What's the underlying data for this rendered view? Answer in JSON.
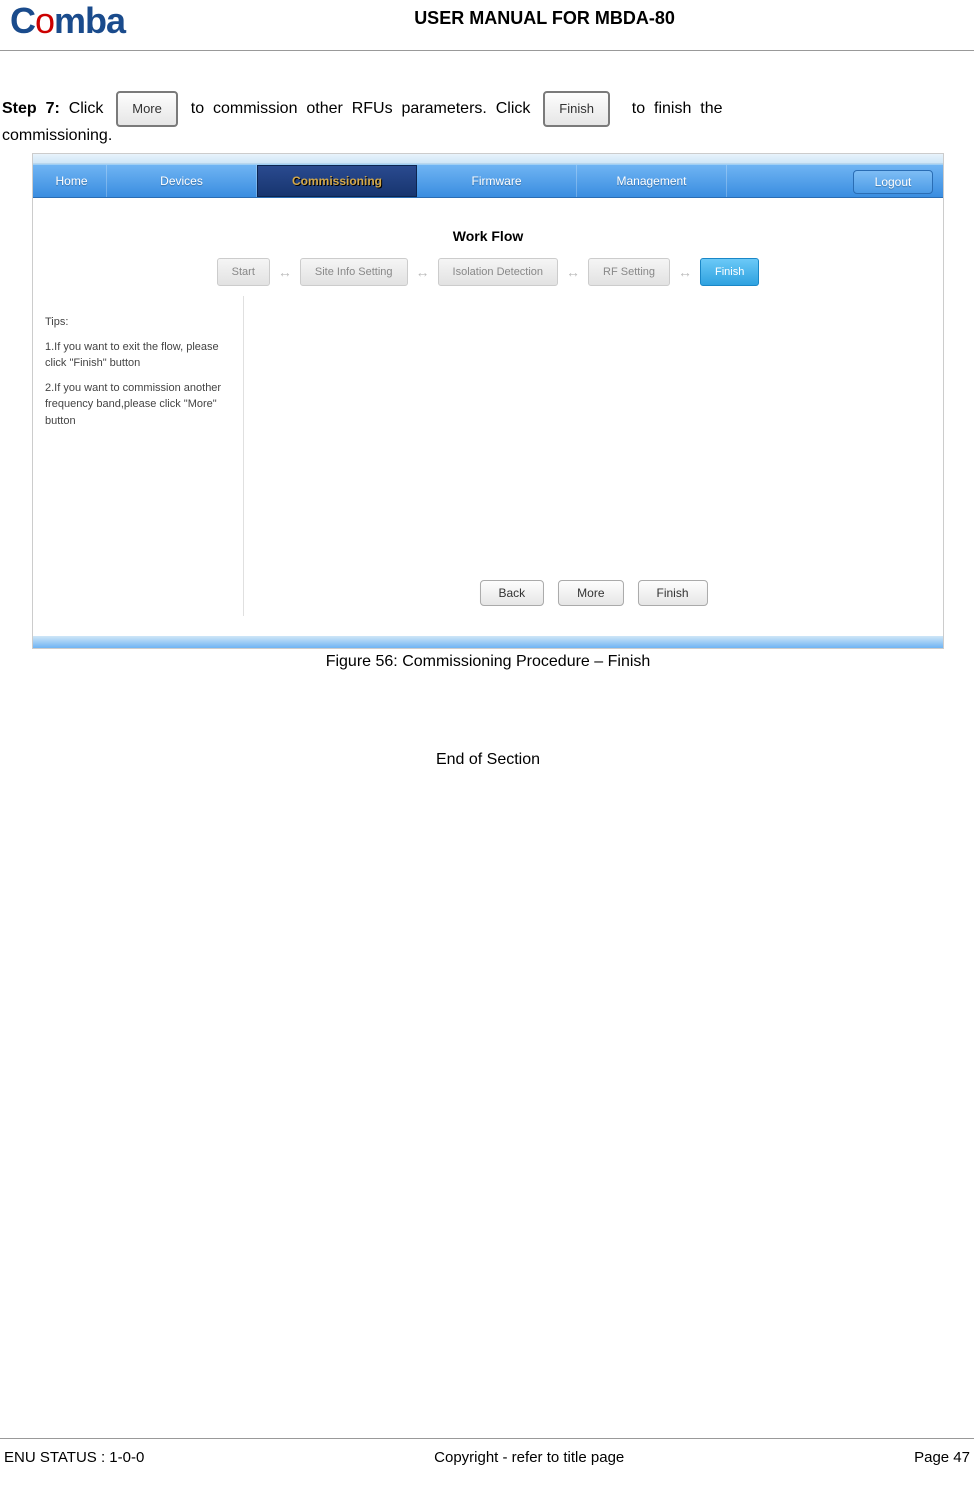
{
  "header": {
    "logo_text": "Comba",
    "title": "USER MANUAL FOR MBDA-80"
  },
  "step": {
    "prefix": "Step  7:",
    "text1": "  Click  ",
    "more_btn": "More",
    "text2": "  to  commission  other  RFUs  parameters.  Click  ",
    "finish_btn": "Finish",
    "text3": "    to  finish  the",
    "text4": "commissioning."
  },
  "nav": {
    "home": "Home",
    "devices": "Devices",
    "commissioning": "Commissioning",
    "firmware": "Firmware",
    "management": "Management",
    "logout": "Logout"
  },
  "workflow": {
    "title": "Work Flow",
    "steps": [
      "Start",
      "Site Info Setting",
      "Isolation Detection",
      "RF Setting",
      "Finish"
    ]
  },
  "tips": {
    "title": "Tips:",
    "t1": "1.If you want to exit the flow, please click \"Finish\" button",
    "t2": "2.If you want to commission another frequency band,please click \"More\" button"
  },
  "buttons": {
    "back": "Back",
    "more": "More",
    "finish": "Finish"
  },
  "caption": "Figure 56: Commissioning Procedure – Finish",
  "end": "End of Section",
  "footer": {
    "left": "ENU STATUS : 1-0-0",
    "center": "Copyright - refer to title page",
    "right": "Page 47"
  }
}
